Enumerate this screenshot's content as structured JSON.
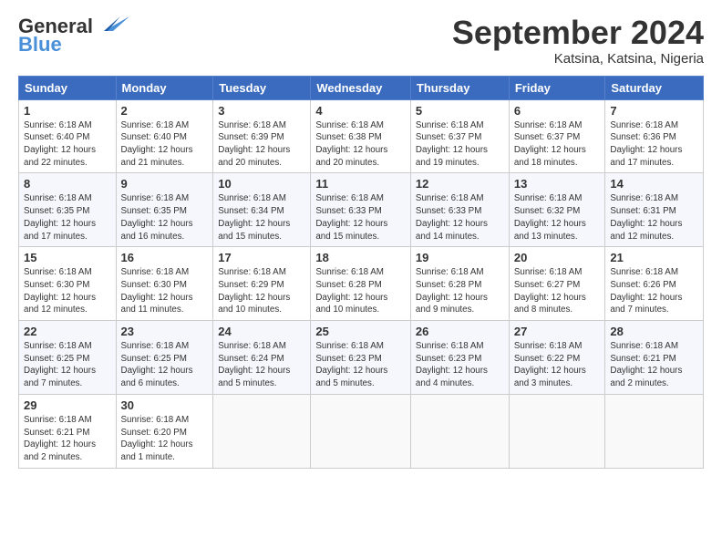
{
  "logo": {
    "part1": "General",
    "part2": "Blue"
  },
  "title": "September 2024",
  "subtitle": "Katsina, Katsina, Nigeria",
  "days_header": [
    "Sunday",
    "Monday",
    "Tuesday",
    "Wednesday",
    "Thursday",
    "Friday",
    "Saturday"
  ],
  "weeks": [
    [
      {
        "day": "1",
        "info": "Sunrise: 6:18 AM\nSunset: 6:40 PM\nDaylight: 12 hours\nand 22 minutes."
      },
      {
        "day": "2",
        "info": "Sunrise: 6:18 AM\nSunset: 6:40 PM\nDaylight: 12 hours\nand 21 minutes."
      },
      {
        "day": "3",
        "info": "Sunrise: 6:18 AM\nSunset: 6:39 PM\nDaylight: 12 hours\nand 20 minutes."
      },
      {
        "day": "4",
        "info": "Sunrise: 6:18 AM\nSunset: 6:38 PM\nDaylight: 12 hours\nand 20 minutes."
      },
      {
        "day": "5",
        "info": "Sunrise: 6:18 AM\nSunset: 6:37 PM\nDaylight: 12 hours\nand 19 minutes."
      },
      {
        "day": "6",
        "info": "Sunrise: 6:18 AM\nSunset: 6:37 PM\nDaylight: 12 hours\nand 18 minutes."
      },
      {
        "day": "7",
        "info": "Sunrise: 6:18 AM\nSunset: 6:36 PM\nDaylight: 12 hours\nand 17 minutes."
      }
    ],
    [
      {
        "day": "8",
        "info": "Sunrise: 6:18 AM\nSunset: 6:35 PM\nDaylight: 12 hours\nand 17 minutes."
      },
      {
        "day": "9",
        "info": "Sunrise: 6:18 AM\nSunset: 6:35 PM\nDaylight: 12 hours\nand 16 minutes."
      },
      {
        "day": "10",
        "info": "Sunrise: 6:18 AM\nSunset: 6:34 PM\nDaylight: 12 hours\nand 15 minutes."
      },
      {
        "day": "11",
        "info": "Sunrise: 6:18 AM\nSunset: 6:33 PM\nDaylight: 12 hours\nand 15 minutes."
      },
      {
        "day": "12",
        "info": "Sunrise: 6:18 AM\nSunset: 6:33 PM\nDaylight: 12 hours\nand 14 minutes."
      },
      {
        "day": "13",
        "info": "Sunrise: 6:18 AM\nSunset: 6:32 PM\nDaylight: 12 hours\nand 13 minutes."
      },
      {
        "day": "14",
        "info": "Sunrise: 6:18 AM\nSunset: 6:31 PM\nDaylight: 12 hours\nand 12 minutes."
      }
    ],
    [
      {
        "day": "15",
        "info": "Sunrise: 6:18 AM\nSunset: 6:30 PM\nDaylight: 12 hours\nand 12 minutes."
      },
      {
        "day": "16",
        "info": "Sunrise: 6:18 AM\nSunset: 6:30 PM\nDaylight: 12 hours\nand 11 minutes."
      },
      {
        "day": "17",
        "info": "Sunrise: 6:18 AM\nSunset: 6:29 PM\nDaylight: 12 hours\nand 10 minutes."
      },
      {
        "day": "18",
        "info": "Sunrise: 6:18 AM\nSunset: 6:28 PM\nDaylight: 12 hours\nand 10 minutes."
      },
      {
        "day": "19",
        "info": "Sunrise: 6:18 AM\nSunset: 6:28 PM\nDaylight: 12 hours\nand 9 minutes."
      },
      {
        "day": "20",
        "info": "Sunrise: 6:18 AM\nSunset: 6:27 PM\nDaylight: 12 hours\nand 8 minutes."
      },
      {
        "day": "21",
        "info": "Sunrise: 6:18 AM\nSunset: 6:26 PM\nDaylight: 12 hours\nand 7 minutes."
      }
    ],
    [
      {
        "day": "22",
        "info": "Sunrise: 6:18 AM\nSunset: 6:25 PM\nDaylight: 12 hours\nand 7 minutes."
      },
      {
        "day": "23",
        "info": "Sunrise: 6:18 AM\nSunset: 6:25 PM\nDaylight: 12 hours\nand 6 minutes."
      },
      {
        "day": "24",
        "info": "Sunrise: 6:18 AM\nSunset: 6:24 PM\nDaylight: 12 hours\nand 5 minutes."
      },
      {
        "day": "25",
        "info": "Sunrise: 6:18 AM\nSunset: 6:23 PM\nDaylight: 12 hours\nand 5 minutes."
      },
      {
        "day": "26",
        "info": "Sunrise: 6:18 AM\nSunset: 6:23 PM\nDaylight: 12 hours\nand 4 minutes."
      },
      {
        "day": "27",
        "info": "Sunrise: 6:18 AM\nSunset: 6:22 PM\nDaylight: 12 hours\nand 3 minutes."
      },
      {
        "day": "28",
        "info": "Sunrise: 6:18 AM\nSunset: 6:21 PM\nDaylight: 12 hours\nand 2 minutes."
      }
    ],
    [
      {
        "day": "29",
        "info": "Sunrise: 6:18 AM\nSunset: 6:21 PM\nDaylight: 12 hours\nand 2 minutes."
      },
      {
        "day": "30",
        "info": "Sunrise: 6:18 AM\nSunset: 6:20 PM\nDaylight: 12 hours\nand 1 minute."
      },
      {
        "day": "",
        "info": ""
      },
      {
        "day": "",
        "info": ""
      },
      {
        "day": "",
        "info": ""
      },
      {
        "day": "",
        "info": ""
      },
      {
        "day": "",
        "info": ""
      }
    ]
  ]
}
